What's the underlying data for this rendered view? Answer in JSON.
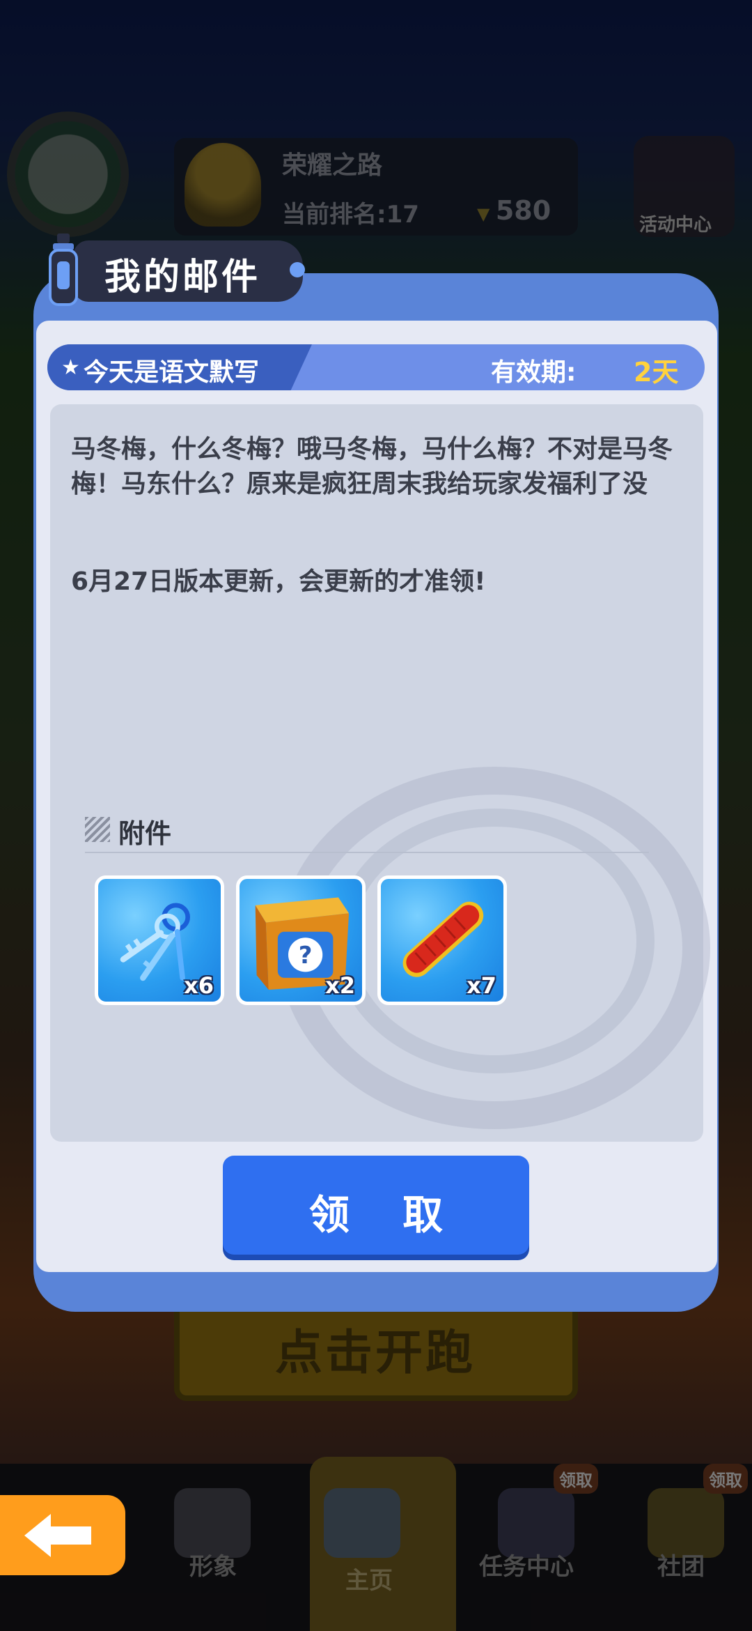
{
  "background": {
    "rank_card": {
      "title": "荣耀之路",
      "rank_text": "当前排名:17",
      "score": "580"
    },
    "event_button": {
      "label": "活动中心"
    },
    "start_button": {
      "label": "点击开跑"
    },
    "bottom_nav": {
      "items": [
        {
          "label": "形象"
        },
        {
          "label": "主页"
        },
        {
          "label": "任务中心",
          "badge": "领取"
        },
        {
          "label": "社团",
          "badge": "领取"
        }
      ]
    }
  },
  "dialog": {
    "title": "我的邮件",
    "subject": "今天是语文默写",
    "expiry_label": "有效期:",
    "expiry_value": "2天",
    "body_line1": "马冬梅，什么冬梅？哦马冬梅，马什么梅？不对是马冬梅！马东什么？原来是疯狂周末我给玩家发福利了没",
    "body_line2": "6月27日版本更新，会更新的才准领!",
    "attachments_label": "附件",
    "attachments": [
      {
        "icon": "keys-icon",
        "count": "x6"
      },
      {
        "icon": "mystery-box-icon",
        "count": "x2"
      },
      {
        "icon": "hoverboard-icon",
        "count": "x7"
      }
    ],
    "claim_button": "领 取"
  },
  "colors": {
    "dialog_frame": "#5a84d8",
    "claim_button": "#2f6ff0",
    "expiry_value": "#ffd23d",
    "back_button": "#ff9d1c"
  }
}
